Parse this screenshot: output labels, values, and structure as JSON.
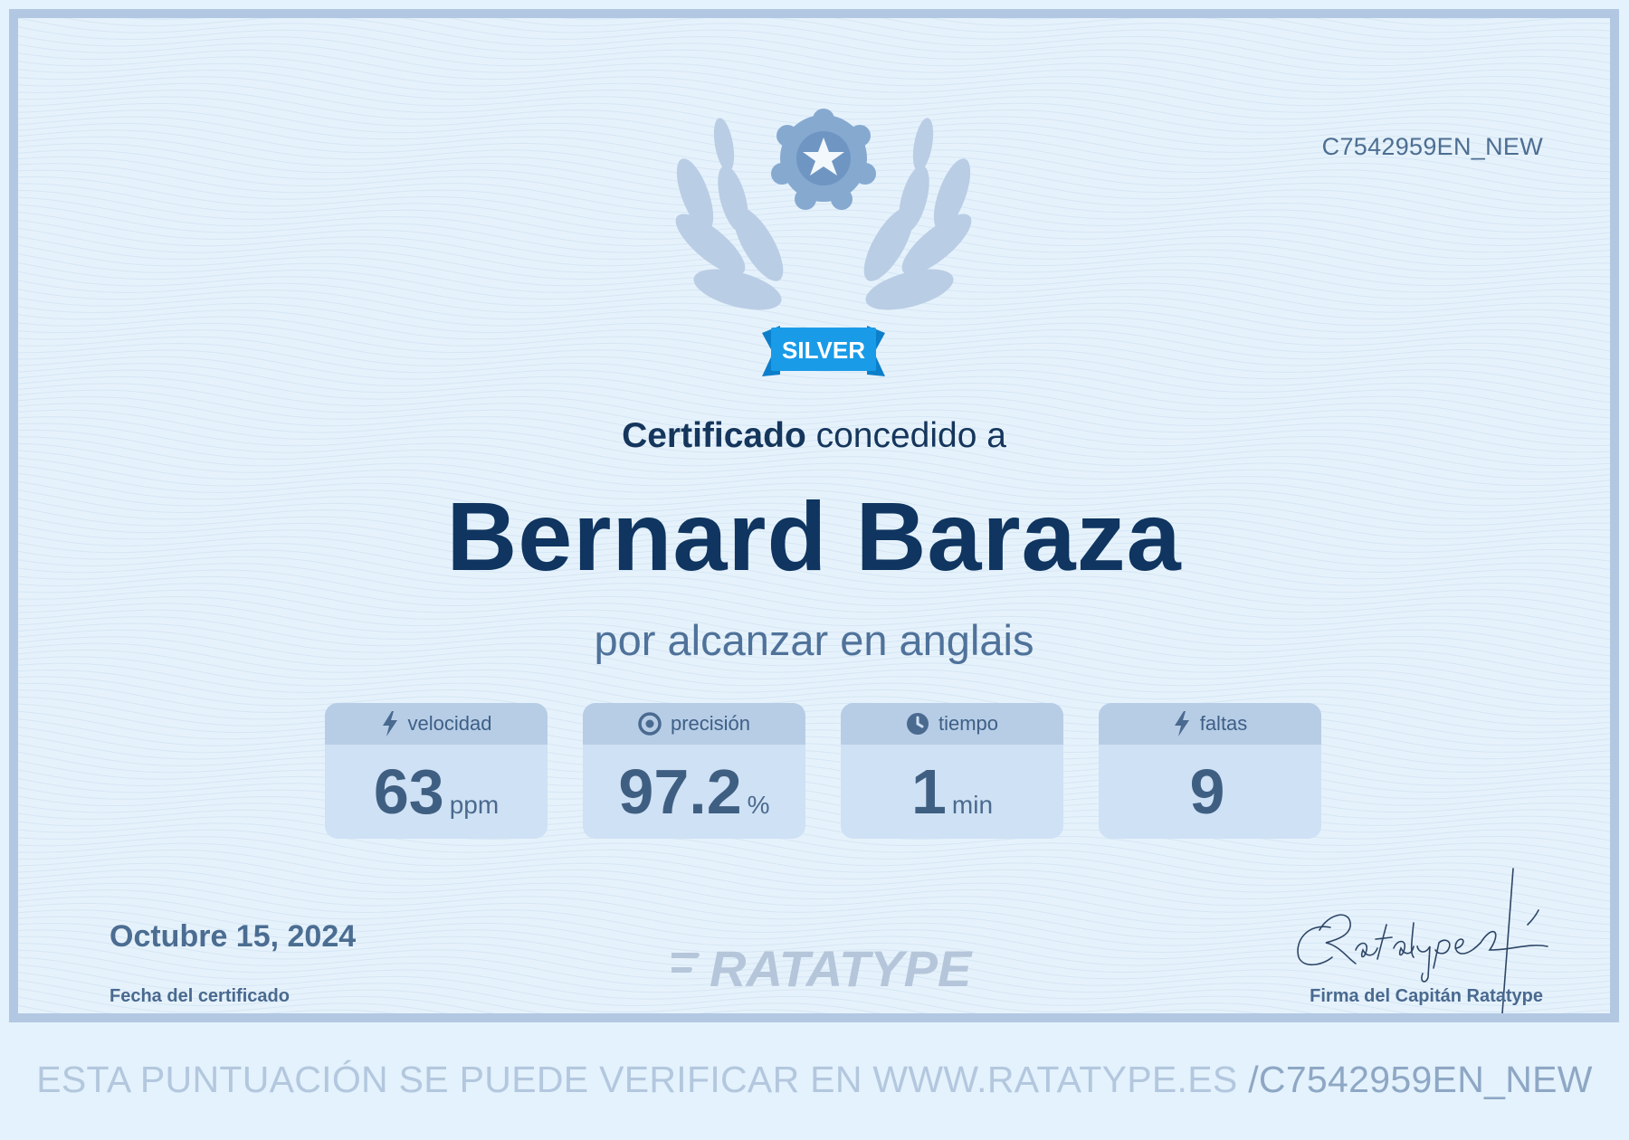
{
  "certificate": {
    "id": "C7542959EN_NEW",
    "level_badge": "SILVER",
    "heading_bold": "Certificado",
    "heading_rest": " concedido a",
    "recipient_name": "Bernard Baraza",
    "subtitle": "por alcanzar en anglais",
    "date": "Octubre 15, 2024",
    "date_label": "Fecha del certificado",
    "signature_label": "Firma del Capitán Ratatype",
    "brand_logo_text": "RATATYPE"
  },
  "stats": [
    {
      "label": "velocidad",
      "value": "63",
      "unit": "ppm",
      "icon": "bolt-icon"
    },
    {
      "label": "precisión",
      "value": "97.2",
      "unit": "%",
      "icon": "target-icon"
    },
    {
      "label": "tiempo",
      "value": "1",
      "unit": "min",
      "icon": "clock-icon"
    },
    {
      "label": "faltas",
      "value": "9",
      "unit": "",
      "icon": "bolt-icon"
    }
  ],
  "footer": {
    "verify_text": "ESTA PUNTUACIÓN SE PUEDE VERIFICAR EN WWW.RATATYPE.ES ",
    "verify_code": "/C7542959EN_NEW"
  },
  "colors": {
    "background": "#e6f2fb",
    "border": "#b2c8e2",
    "name_text": "#0f3560",
    "badge": "#1a9be8",
    "stat_card": "#cfe1f4"
  }
}
